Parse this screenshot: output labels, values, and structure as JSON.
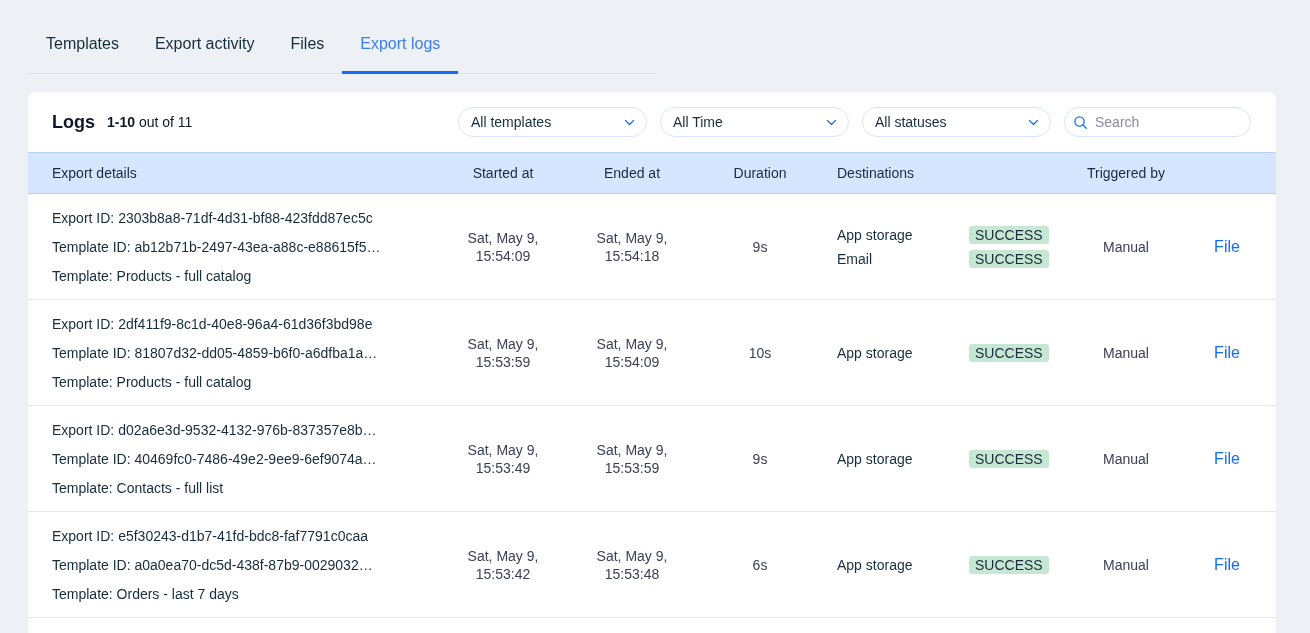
{
  "tabs": [
    {
      "label": "Templates",
      "selected": false
    },
    {
      "label": "Export activity",
      "selected": false
    },
    {
      "label": "Files",
      "selected": false
    },
    {
      "label": "Export logs",
      "selected": true
    }
  ],
  "logs": {
    "title": "Logs",
    "count": "**1-10** out of 11",
    "filters": [
      {
        "kind": "dropdown",
        "value": "All templates"
      },
      {
        "kind": "dropdown",
        "value": "All Time"
      },
      {
        "kind": "dropdown",
        "value": "All statuses"
      },
      {
        "kind": "search",
        "placeholder": "Search"
      }
    ],
    "table": {
      "columns": [
        {
          "label": "Export details"
        },
        {
          "label": "Started at"
        },
        {
          "label": "Ended at"
        },
        {
          "label": "Duration"
        },
        {
          "label": "Destinations"
        },
        {
          "label": "Triggered by"
        }
      ],
      "rows": [
        {
          "export_id": "Export ID: 2303b8a8-71df-4d31-bf88-423fdd87ec5c",
          "template_id": "Template ID: ab12b71b-2497-43ea-a88c-e88615f5…",
          "template": "Template: Products - full catalog",
          "started_at": "Sat, May 9, 15:54:09",
          "ended_at": "Sat, May 9, 15:54:18",
          "duration": "9s",
          "destinations": [
            {
              "name": "App storage",
              "status": "SUCCESS"
            },
            {
              "name": "Email",
              "status": "SUCCESS"
            }
          ],
          "triggered_by": "Manual",
          "link": "File"
        },
        {
          "export_id": "Export ID: 2df411f9-8c1d-40e8-96a4-61d36f3bd98e",
          "template_id": "Template ID: 81807d32-dd05-4859-b6f0-a6dfba1a…",
          "template": "Template: Products - full catalog",
          "started_at": "Sat, May 9, 15:53:59",
          "ended_at": "Sat, May 9, 15:54:09",
          "duration": "10s",
          "destinations": [
            {
              "name": "App storage",
              "status": "SUCCESS"
            }
          ],
          "triggered_by": "Manual",
          "link": "File"
        },
        {
          "export_id": "Export ID: d02a6e3d-9532-4132-976b-837357e8b…",
          "template_id": "Template ID: 40469fc0-7486-49e2-9ee9-6ef9074a…",
          "template": "Template: Contacts - full list",
          "started_at": "Sat, May 9, 15:53:49",
          "ended_at": "Sat, May 9, 15:53:59",
          "duration": "9s",
          "destinations": [
            {
              "name": "App storage",
              "status": "SUCCESS"
            }
          ],
          "triggered_by": "Manual",
          "link": "File"
        },
        {
          "export_id": "Export ID: e5f30243-d1b7-41fd-bdc8-faf7791c0caa",
          "template_id": "Template ID: a0a0ea70-dc5d-438f-87b9-0029032…",
          "template": "Template: Orders - last 7 days",
          "started_at": "Sat, May 9, 15:53:42",
          "ended_at": "Sat, May 9, 15:53:48",
          "duration": "6s",
          "destinations": [
            {
              "name": "App storage",
              "status": "SUCCESS"
            }
          ],
          "triggered_by": "Manual",
          "link": "File"
        }
      ]
    }
  }
}
